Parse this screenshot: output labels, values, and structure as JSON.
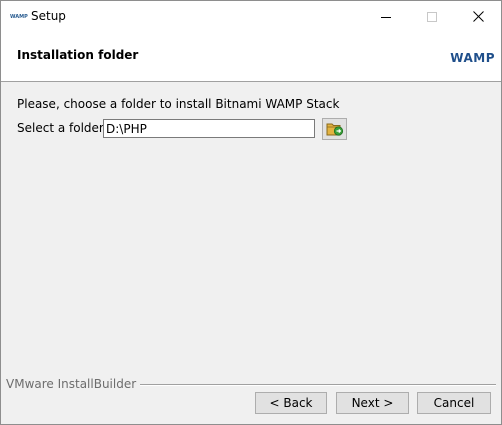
{
  "window": {
    "icon_text": "WAMP",
    "title": "Setup"
  },
  "header": {
    "title": "Installation folder",
    "logo": "WAMP"
  },
  "content": {
    "instruction": "Please, choose a folder to install Bitnami WAMP Stack",
    "folder_label": "Select a folder",
    "folder_value": "D:\\PHP"
  },
  "icons": {
    "app": "wamp-app-icon",
    "minimize": "minimize-icon",
    "maximize": "maximize-icon",
    "close": "close-icon",
    "browse": "folder-browse-icon"
  },
  "footer": {
    "vendor": "VMware InstallBuilder",
    "back_label": "< Back",
    "next_label": "Next >",
    "cancel_label": "Cancel"
  },
  "colors": {
    "brand": "#1f4f8b",
    "window_bg": "#f0f0f0",
    "button_bg": "#e1e1e1"
  }
}
